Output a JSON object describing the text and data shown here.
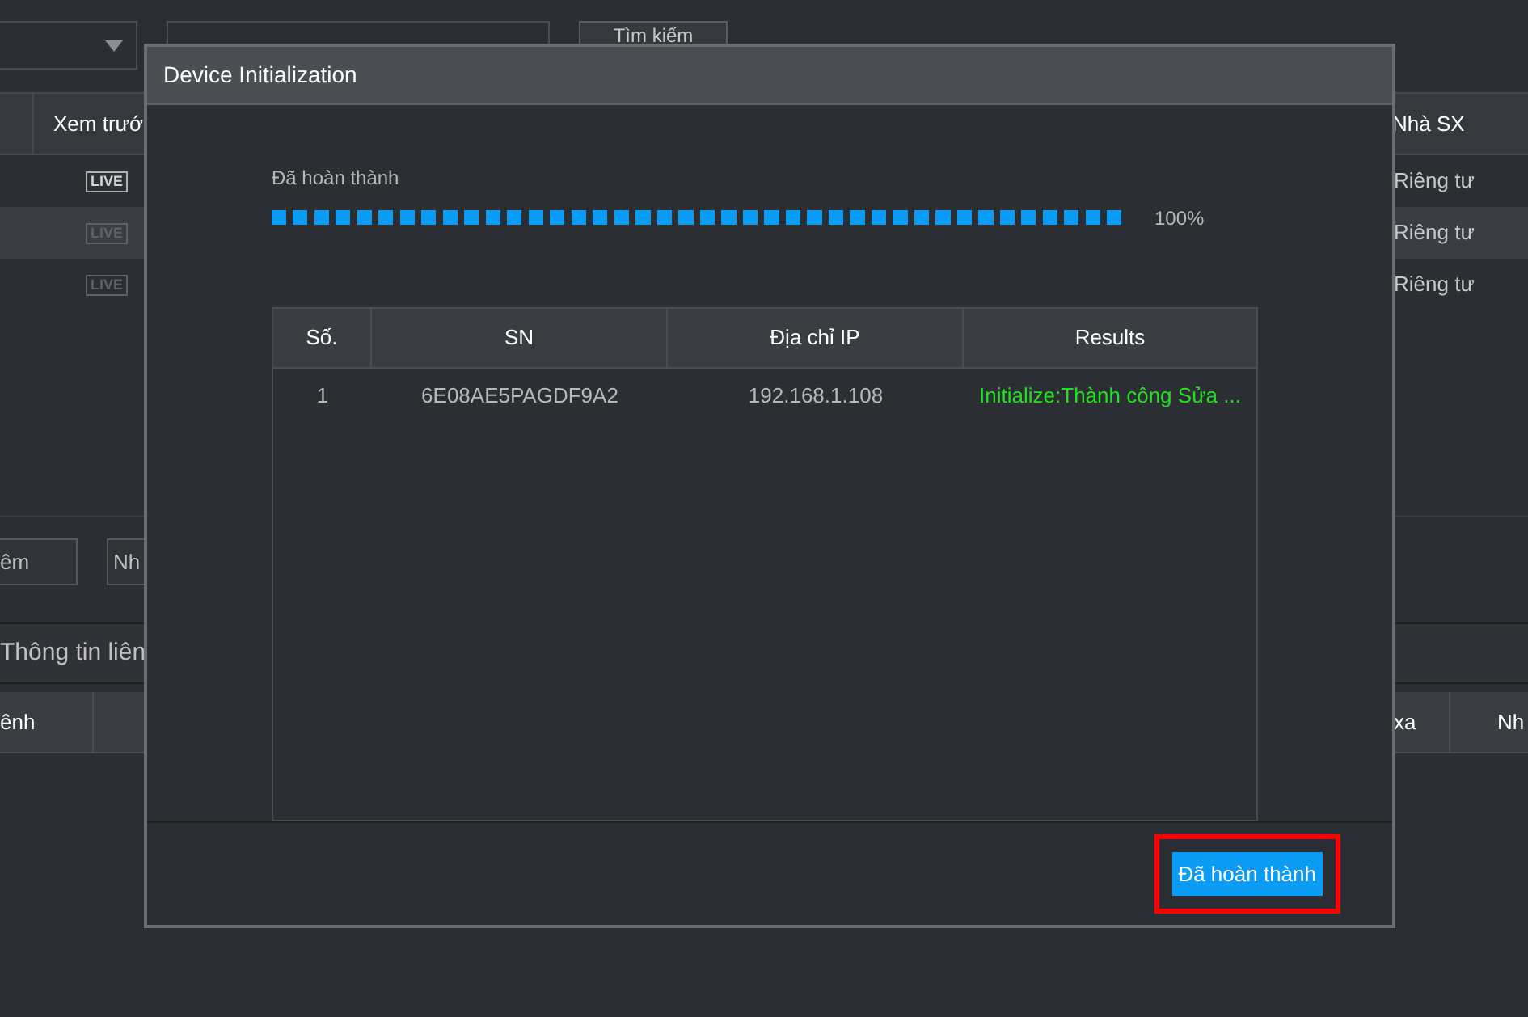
{
  "toolbar": {
    "search_button": "Tìm kiếm"
  },
  "device_table": {
    "columns": [
      "Xem trướ",
      "Nhà SX"
    ],
    "rows": [
      {
        "preview": "LIVE",
        "vendor": "Riêng tư",
        "selected": false,
        "disabled": false
      },
      {
        "preview": "LIVE",
        "vendor": "Riêng tư",
        "selected": true,
        "disabled": true
      },
      {
        "preview": "LIVE",
        "vendor": "Riêng tư",
        "selected": false,
        "disabled": true
      }
    ]
  },
  "filter_fields": [
    {
      "value": "êm"
    },
    {
      "value": "Nh"
    }
  ],
  "section_tab": "Thông tin liên",
  "lower_table": {
    "columns": [
      "ênh",
      "xa",
      "Nh"
    ]
  },
  "dialog": {
    "title": "Device Initialization",
    "status": "Đã hoàn thành",
    "progress": {
      "level": 1.0,
      "reading": "100%"
    },
    "table": {
      "columns": [
        "Số.",
        "SN",
        "Địa chỉ IP",
        "Results"
      ],
      "rows": [
        {
          "no": "1",
          "sn": "6E08AE5PAGDF9A2",
          "ip": "192.168.1.108",
          "result": "Initialize:Thành công Sửa ...",
          "color": "#22e022"
        }
      ]
    },
    "button": "Đã hoàn thành",
    "highlighted": true
  }
}
